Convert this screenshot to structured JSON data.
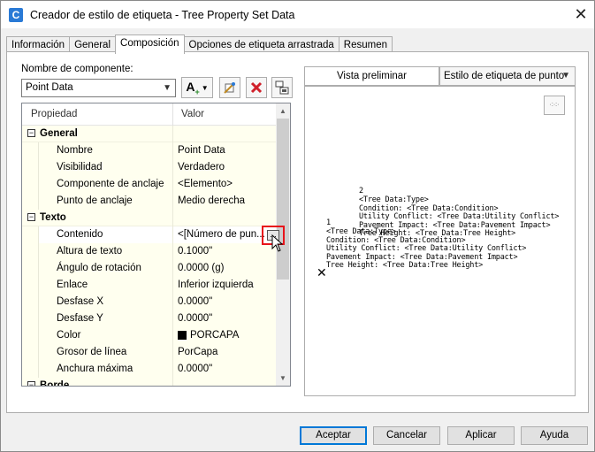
{
  "window": {
    "title": "Creador de estilo de etiqueta - Tree Property Set Data",
    "app_icon_letter": "C",
    "close_glyph": "✕"
  },
  "tabs": [
    "Información",
    "General",
    "Composición",
    "Opciones de etiqueta arrastrada",
    "Resumen"
  ],
  "composition": {
    "component_label": "Nombre de componente:",
    "component_value": "Point Data",
    "grid": {
      "header_property": "Propiedad",
      "header_value": "Valor",
      "rows": [
        {
          "kind": "cat",
          "label": "General",
          "value": ""
        },
        {
          "kind": "prop",
          "label": "Nombre",
          "value": "Point Data"
        },
        {
          "kind": "prop",
          "label": "Visibilidad",
          "value": "Verdadero"
        },
        {
          "kind": "prop",
          "label": "Componente de anclaje",
          "value": "<Elemento>"
        },
        {
          "kind": "prop",
          "label": "Punto de anclaje",
          "value": "Medio derecha"
        },
        {
          "kind": "cat",
          "label": "Texto",
          "value": ""
        },
        {
          "kind": "prop",
          "label": "Contenido",
          "value": "<[Número de pun...",
          "selected": true
        },
        {
          "kind": "prop",
          "label": "Altura de texto",
          "value": "0.1000\""
        },
        {
          "kind": "prop",
          "label": "Ángulo de rotación",
          "value": "0.0000 (g)"
        },
        {
          "kind": "prop",
          "label": "Enlace",
          "value": "Inferior izquierda"
        },
        {
          "kind": "prop",
          "label": "Desfase X",
          "value": "0.0000\""
        },
        {
          "kind": "prop",
          "label": "Desfase Y",
          "value": "0.0000\""
        },
        {
          "kind": "prop",
          "label": "Color",
          "value": "PORCAPA",
          "swatch": true
        },
        {
          "kind": "prop",
          "label": "Grosor de línea",
          "value": "PorCapa"
        },
        {
          "kind": "prop",
          "label": "Anchura máxima",
          "value": "0.0000\""
        },
        {
          "kind": "cat",
          "label": "Borde",
          "value": ""
        }
      ]
    }
  },
  "preview": {
    "tab_label": "Vista preliminar",
    "style_value": "Estilo de etiqueta de punto",
    "icon_glyph": "·:·:·",
    "upper_block": {
      "number": "2",
      "lines": [
        "<Tree Data:Type>",
        "Condition: <Tree Data:Condition>",
        "Utility Conflict: <Tree Data:Utility Conflict>",
        "Pavement Impact: <Tree Data:Pavement Impact>",
        "Tree Height: <Tree Data:Tree Height>"
      ]
    },
    "lower_block": {
      "number": "1",
      "lines": [
        "<Tree Data:Type>",
        "Condition: <Tree Data:Condition>",
        "Utility Conflict: <Tree Data:Utility Conflict>",
        "Pavement Impact: <Tree Data:Pavement Impact>",
        "Tree Height: <Tree Data:Tree Height>"
      ]
    },
    "marker_glyph": "✕"
  },
  "buttons": {
    "accept": "Aceptar",
    "cancel": "Cancelar",
    "apply": "Aplicar",
    "help": "Ayuda"
  },
  "colors": {
    "accent": "#0078d7",
    "highlight": "#e8141b",
    "delete": "#d0202a"
  }
}
